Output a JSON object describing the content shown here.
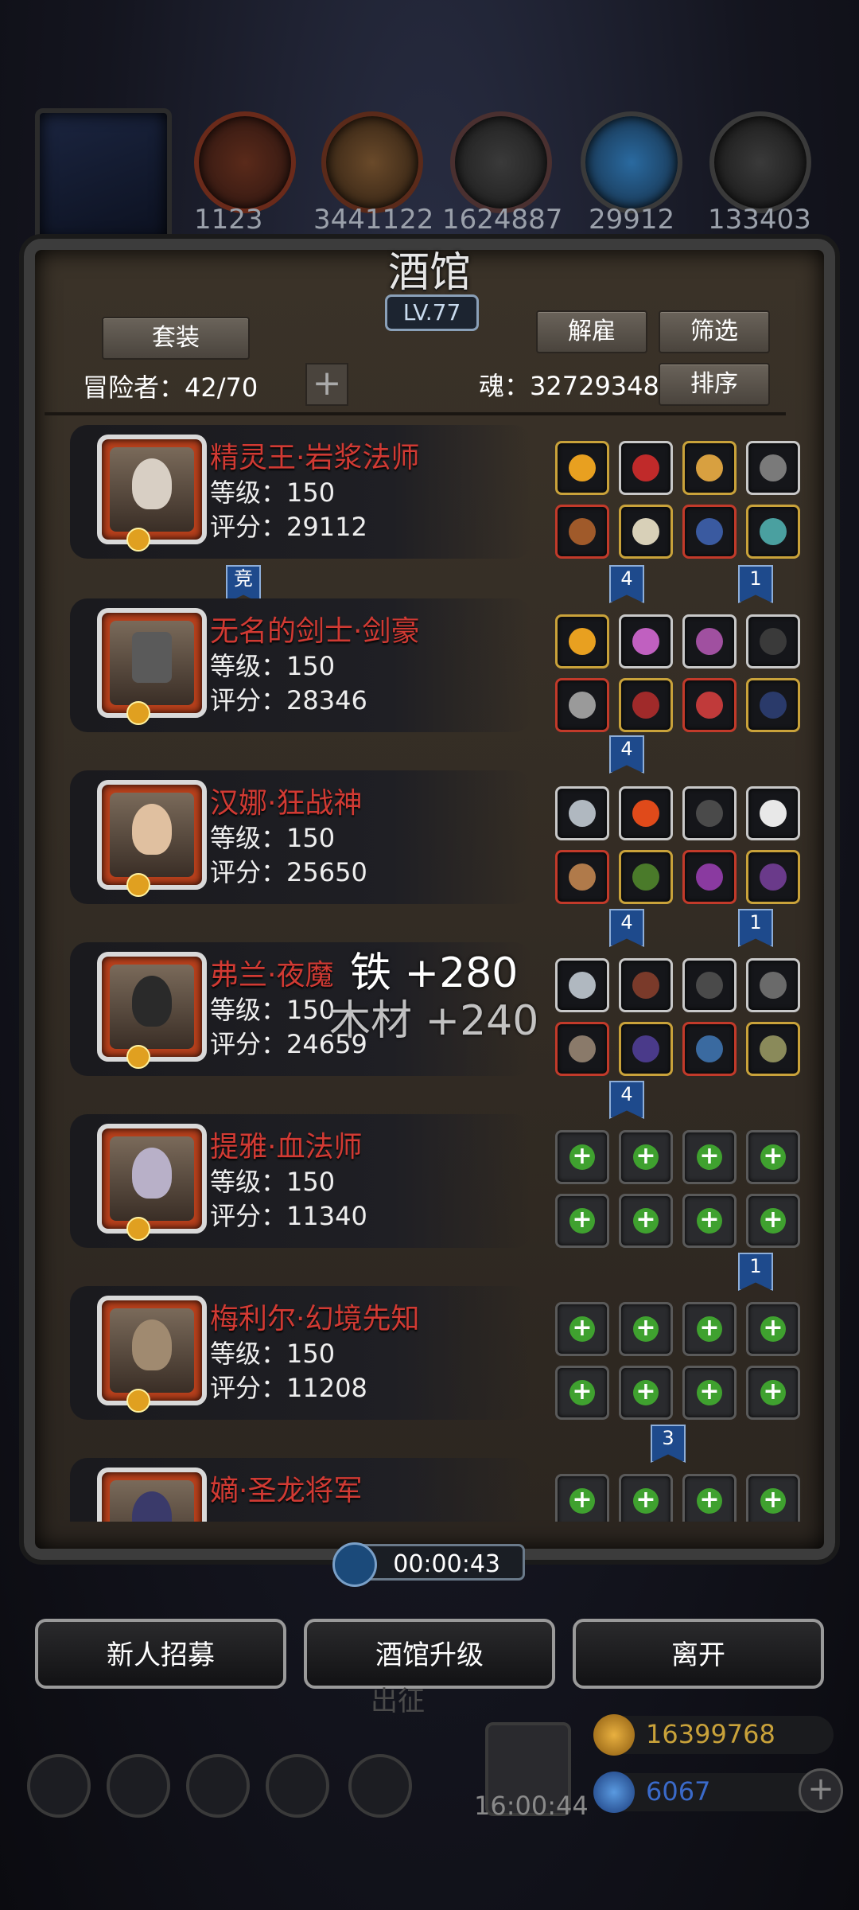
{
  "top_resources": [
    "1123",
    "3441122",
    "1624887",
    "29912",
    "133403"
  ],
  "header": {
    "title": "酒馆",
    "level": "LV.77"
  },
  "controls": {
    "suit_label": "套装",
    "dismiss_label": "解雇",
    "filter_label": "筛选",
    "sort_label": "排序",
    "adventurers": "冒险者：42/70",
    "soul": "魂：32729348"
  },
  "heroes": [
    {
      "name": "精灵王·岩浆法师",
      "level": "等级：150",
      "score": "评分：29112"
    },
    {
      "name": "无名的剑士·剑豪",
      "level": "等级：150",
      "score": "评分：28346"
    },
    {
      "name": "汉娜·狂战神",
      "level": "等级：150",
      "score": "评分：25650"
    },
    {
      "name": "弗兰·夜魔",
      "level": "等级：150",
      "score": "评分：24659"
    },
    {
      "name": "提雅·血法师",
      "level": "等级：150",
      "score": "评分：11340"
    },
    {
      "name": "梅利尔·幻境先知",
      "level": "等级：150",
      "score": "评分：11208"
    },
    {
      "name": "嫡·圣龙将军",
      "level": "",
      "score": ""
    }
  ],
  "ribbons": [
    "竞",
    "4",
    "1",
    "4",
    "4",
    "1",
    "4",
    "1",
    "3"
  ],
  "floating_text": {
    "iron": "铁 +280",
    "wood": "木材 +240"
  },
  "timer": "00:00:43",
  "buttons": {
    "recruit": "新人招募",
    "upgrade": "酒馆升级",
    "leave": "离开"
  },
  "bottom": {
    "ghost_label": "出征",
    "gift_timer": "16:00:44",
    "gold": "16399768",
    "gems": "6067"
  },
  "colors": {
    "hero_name": "#d13a33",
    "gold": "#c9a23a",
    "gem": "#3a6ac9",
    "add": "#3fa12f"
  }
}
